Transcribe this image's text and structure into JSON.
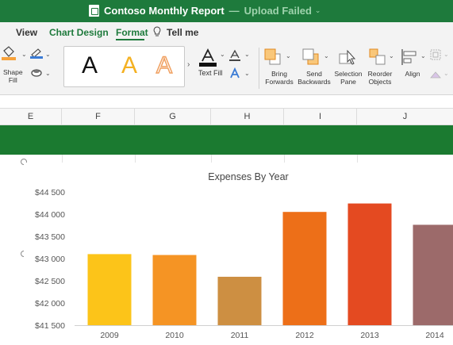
{
  "window": {
    "title": "Contoso Monthly Report",
    "separator": "—",
    "status": "Upload Failed"
  },
  "tabs": {
    "view": "View",
    "chart_design": "Chart Design",
    "format": "Format",
    "tell_me": "Tell me"
  },
  "ribbon": {
    "shape_fill_label": "Shape\nFill",
    "wordart_sample": "A",
    "text_fill_label": "Text Fill",
    "bring_forwards_label": "Bring\nForwards",
    "send_backwards_label": "Send\nBackwards",
    "selection_pane_label": "Selection\nPane",
    "reorder_objects_label": "Reorder\nObjects",
    "align_label": "Align",
    "colors": {
      "accent_green": "#1e7a3c",
      "shape_fill_orange": "#f7a23b",
      "wordart_yellow": "#f4b122",
      "wordart_orange_outline": "#f0a060"
    }
  },
  "columns": [
    "E",
    "F",
    "G",
    "H",
    "I",
    "J"
  ],
  "sheet": {
    "header_band_color": "#1b7a30"
  },
  "chart_data": {
    "type": "bar",
    "title": "Expenses By Year",
    "categories": [
      "2009",
      "2010",
      "2011",
      "2012",
      "2013",
      "2014"
    ],
    "values": [
      43100,
      43080,
      42590,
      44050,
      44240,
      43760
    ],
    "colors": [
      "#fcc419",
      "#f59424",
      "#cd8f42",
      "#ed6f18",
      "#e44a21",
      "#9c6a6a"
    ],
    "ylim": [
      41500,
      44500
    ],
    "yticks": [
      "$44 500",
      "$44 000",
      "$43 500",
      "$43 000",
      "$42 500",
      "$42 000",
      "$41 500"
    ],
    "ytick_values": [
      44500,
      44000,
      43500,
      43000,
      42500,
      42000,
      41500
    ],
    "xlabel": "",
    "ylabel": "",
    "grid": false,
    "legend": "none"
  }
}
